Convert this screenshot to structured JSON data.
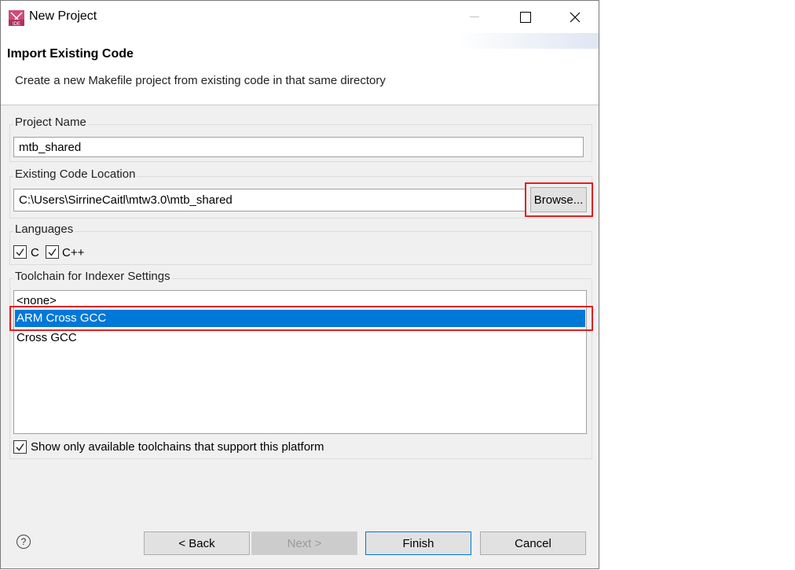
{
  "window": {
    "title": "New Project",
    "app_icon": "ide-icon",
    "controls": [
      "minimize-icon",
      "maximize-icon",
      "close-icon"
    ]
  },
  "header": {
    "title": "Import Existing Code",
    "description": "Create a new Makefile project from existing code in that same directory"
  },
  "project_name": {
    "label": "Project Name",
    "value": "mtb_shared"
  },
  "code_location": {
    "label": "Existing Code Location",
    "value": "C:\\Users\\SirrineCaitl\\mtw3.0\\mtb_shared",
    "browse_label": "Browse..."
  },
  "languages": {
    "label": "Languages",
    "c_label": "C",
    "c_checked": true,
    "cpp_label": "C++",
    "cpp_checked": true
  },
  "toolchain": {
    "label": "Toolchain for Indexer Settings",
    "items": [
      "<none>",
      "ARM Cross GCC",
      "Cross GCC"
    ],
    "selected": "ARM Cross GCC",
    "filter_label": "Show only available toolchains that support this platform",
    "filter_checked": true
  },
  "footer": {
    "help_icon": "help-icon",
    "back_label": "< Back",
    "next_label": "Next >",
    "finish_label": "Finish",
    "cancel_label": "Cancel"
  },
  "colors": {
    "selection": "#0078d7",
    "highlight_box": "#e02020",
    "dialog_bg": "#f0f0f0"
  }
}
